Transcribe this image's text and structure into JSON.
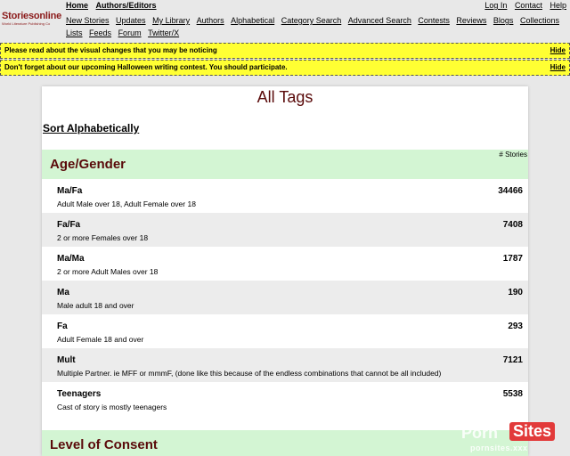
{
  "header": {
    "logo_main": "Storiesonline",
    "logo_sub": "World Literature Publishing Co",
    "top_links": [
      "Home",
      "Authors/Editors"
    ],
    "right_links": [
      "Log In",
      "Contact",
      "Help"
    ],
    "nav_links": [
      "New Stories",
      "Updates",
      "My Library",
      "Authors",
      "Alphabetical",
      "Category Search",
      "Advanced Search",
      "Contests",
      "Reviews",
      "Blogs",
      "Collections",
      "Lists",
      "Feeds",
      "Forum",
      "Twitter/X"
    ]
  },
  "notices": [
    {
      "text": "Please read about the visual changes that you may be noticing",
      "hide_label": "Hide"
    },
    {
      "text": "Don't forget about our upcoming Halloween writing contest. You should participate.",
      "hide_label": "Hide"
    }
  ],
  "main": {
    "title": "All Tags",
    "sort_label": "Sort Alphabetically",
    "count_header": "# Stories",
    "sections": [
      {
        "title": "Age/Gender",
        "tags": [
          {
            "name": "Ma/Fa",
            "desc": "Adult Male over 18, Adult Female over 18",
            "count": "34466"
          },
          {
            "name": "Fa/Fa",
            "desc": "2 or more Females over 18",
            "count": "7408"
          },
          {
            "name": "Ma/Ma",
            "desc": "2 or more Adult Males over 18",
            "count": "1787"
          },
          {
            "name": "Ma",
            "desc": "Male adult 18 and over",
            "count": "190"
          },
          {
            "name": "Fa",
            "desc": "Adult Female 18 and over",
            "count": "293"
          },
          {
            "name": "Mult",
            "desc": "Multiple Partner. ie MFF or mmmF, (done like this because of the endless combinations that cannot be all included)",
            "count": "7121"
          },
          {
            "name": "Teenagers",
            "desc": "Cast of story is mostly teenagers",
            "count": "5538"
          }
        ]
      },
      {
        "title": "Level of Consent",
        "tags": []
      }
    ]
  },
  "watermark": {
    "porn": "Porn",
    "sites": "Sites",
    "url": "pornsites.xxx"
  }
}
